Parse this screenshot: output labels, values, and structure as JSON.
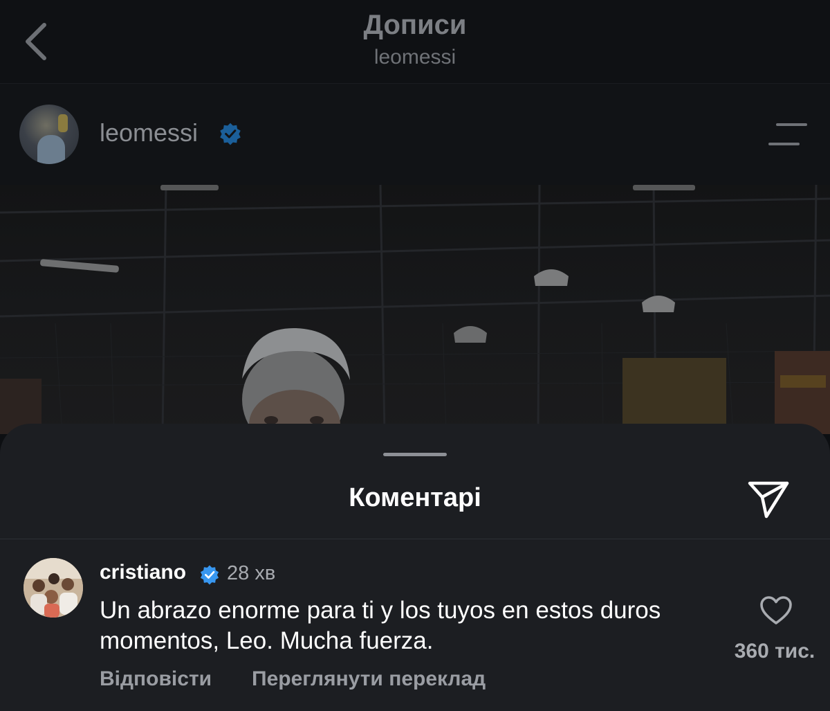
{
  "nav": {
    "title": "Дописи",
    "subtitle": "leomessi",
    "back_icon": "chevron-left-icon"
  },
  "post": {
    "username": "leomessi",
    "verified": true,
    "menu_icon": "hamburger-menu-icon"
  },
  "sheet": {
    "title": "Коментарі",
    "share_icon": "send-icon"
  },
  "comment": {
    "username": "cristiano",
    "verified": true,
    "time": "28 хв",
    "text": "Un abrazo enorme para ti y los tuyos en estos duros momentos, Leo. Mucha fuerza.",
    "reply_label": "Відповісти",
    "translate_label": "Переглянути переклад",
    "like_count": "360 тис.",
    "like_icon": "heart-icon"
  },
  "colors": {
    "background": "#0d0f12",
    "sheet": "#1c1e22",
    "verified": "#3897f0",
    "text_primary": "#ffffff",
    "text_secondary": "#9a9da3"
  }
}
